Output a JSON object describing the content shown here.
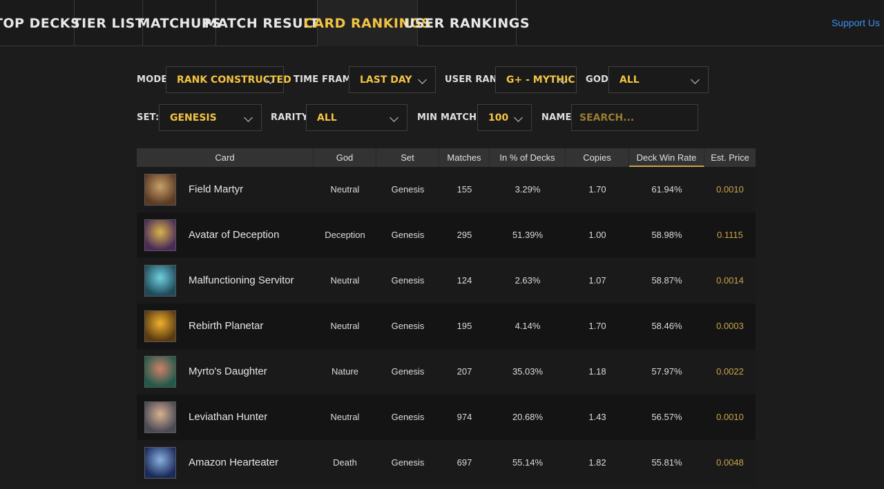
{
  "nav": {
    "tabs": [
      "TOP DECKS",
      "TIER LIST",
      "MATCHUPS",
      "MATCH RESULTS",
      "CARD RANKINGS",
      "USER RANKINGS"
    ],
    "active_tab": "CARD RANKINGS",
    "support_label": "Support Us"
  },
  "filters": {
    "mode": {
      "label": "MODE:",
      "value": "RANK CONSTRUCTED"
    },
    "time_frame": {
      "label": "TIME FRAME:",
      "value": "LAST DAY"
    },
    "user_rank": {
      "label": "USER RANK:",
      "value": "G+ - MYTHIC"
    },
    "god": {
      "label": "GOD:",
      "value": "ALL"
    },
    "set": {
      "label": "SET:",
      "value": "GENESIS"
    },
    "rarity": {
      "label": "RARITY:",
      "value": "ALL"
    },
    "min_matches": {
      "label": "MIN MATCHES:",
      "value": "100"
    },
    "name": {
      "label": "NAME:",
      "placeholder": "SEARCH..."
    }
  },
  "table": {
    "columns": [
      "Card",
      "God",
      "Set",
      "Matches",
      "In % of Decks",
      "Copies",
      "Deck Win Rate",
      "Est. Price"
    ],
    "sorted_column": "Deck Win Rate",
    "rows": [
      {
        "card": "Field Martyr",
        "god": "Neutral",
        "set": "Genesis",
        "matches": "155",
        "in_pct": "3.29%",
        "copies": "1.70",
        "win_rate": "61.94%",
        "price": "0.0010",
        "art": [
          "#5a3a22",
          "#c9a06a"
        ]
      },
      {
        "card": "Avatar of Deception",
        "god": "Deception",
        "set": "Genesis",
        "matches": "295",
        "in_pct": "51.39%",
        "copies": "1.00",
        "win_rate": "58.98%",
        "price": "0.1115",
        "art": [
          "#4a2a5a",
          "#d8b44a"
        ]
      },
      {
        "card": "Malfunctioning Servitor",
        "god": "Neutral",
        "set": "Genesis",
        "matches": "124",
        "in_pct": "2.63%",
        "copies": "1.07",
        "win_rate": "58.87%",
        "price": "0.0014",
        "art": [
          "#1f4a5a",
          "#6fd0e0"
        ]
      },
      {
        "card": "Rebirth Planetar",
        "god": "Neutral",
        "set": "Genesis",
        "matches": "195",
        "in_pct": "4.14%",
        "copies": "1.70",
        "win_rate": "58.46%",
        "price": "0.0003",
        "art": [
          "#5a3a10",
          "#f0b030"
        ]
      },
      {
        "card": "Myrto's Daughter",
        "god": "Nature",
        "set": "Genesis",
        "matches": "207",
        "in_pct": "35.03%",
        "copies": "1.18",
        "win_rate": "57.97%",
        "price": "0.0022",
        "art": [
          "#1f5a4a",
          "#d0806a"
        ]
      },
      {
        "card": "Leviathan Hunter",
        "god": "Neutral",
        "set": "Genesis",
        "matches": "974",
        "in_pct": "20.68%",
        "copies": "1.43",
        "win_rate": "56.57%",
        "price": "0.0010",
        "art": [
          "#4a4a55",
          "#d8b090"
        ]
      },
      {
        "card": "Amazon Hearteater",
        "god": "Death",
        "set": "Genesis",
        "matches": "697",
        "in_pct": "55.14%",
        "copies": "1.82",
        "win_rate": "55.81%",
        "price": "0.0048",
        "art": [
          "#1a2a5a",
          "#8ab0e0"
        ]
      }
    ]
  },
  "colors": {
    "accent": "#f3c442",
    "price": "#c9a44b",
    "link": "#3d8ef0"
  }
}
